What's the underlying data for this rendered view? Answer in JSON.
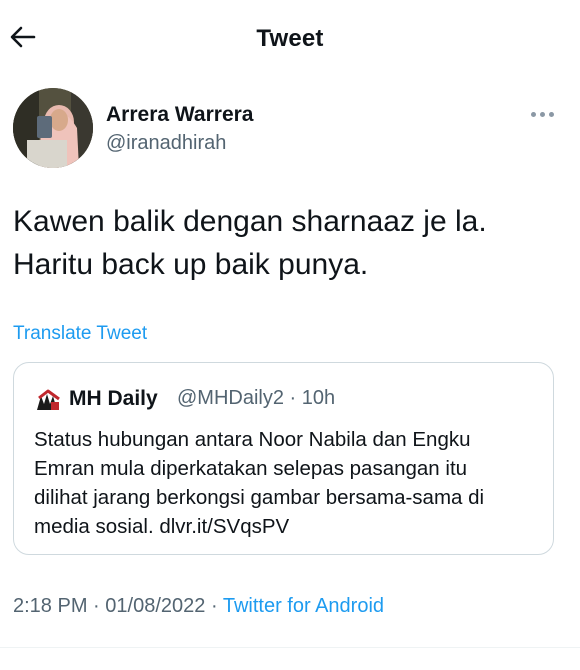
{
  "header": {
    "title": "Tweet"
  },
  "author": {
    "name": "Arrera Warrera",
    "handle": "@iranadhirah"
  },
  "tweet": {
    "lines": [
      "Kawen balik dengan sharnaaz je la.",
      "Haritu back up baik punya."
    ],
    "translate_label": "Translate Tweet"
  },
  "quote": {
    "name": "MH Daily",
    "handle": "@MHDaily2",
    "separator": "·",
    "age": "10h",
    "lines": [
      "Status hubungan antara Noor Nabila dan Engku",
      "Emran mula diperkatakan selepas pasangan itu",
      "dilihat jarang berkongsi gambar bersama-sama di",
      "media sosial. dlvr.it/SVqsPV"
    ]
  },
  "meta": {
    "time": "2:18 PM",
    "separator": "·",
    "date": "01/08/2022",
    "source": "Twitter for Android"
  },
  "colors": {
    "accent": "#1d9bf0",
    "text": "#0f1419",
    "secondary": "#536471",
    "border": "#cfd9de"
  },
  "icons": {
    "back": "arrow-left-icon",
    "more": "more-horizontal-icon"
  }
}
